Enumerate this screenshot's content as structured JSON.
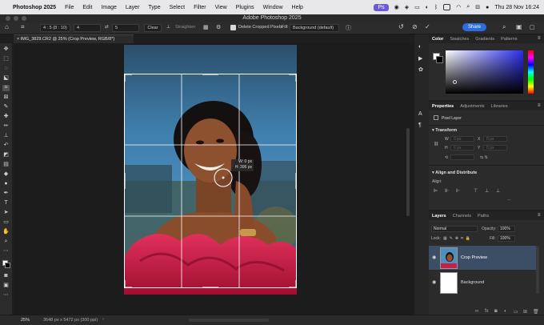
{
  "menubar": {
    "apple": "",
    "app_name": "Photoshop 2025",
    "items": [
      "File",
      "Edit",
      "Image",
      "Layer",
      "Type",
      "Select",
      "Filter",
      "View",
      "Plugins",
      "Window",
      "Help"
    ],
    "ps_badge": "Ps",
    "datetime": "Thu 28 Nov 16:24"
  },
  "window": {
    "title": "Adobe Photoshop 2025"
  },
  "options": {
    "ratio": "4 : 5 (8 : 10)",
    "width_value": "4",
    "height_value": "5",
    "clear_label": "Clear",
    "straighten_label": "Straighten",
    "delete_cropped_label": "Delete Cropped Pixels",
    "fill_label": "Fill:",
    "fill_value": "Background (default)",
    "share_label": "Share"
  },
  "document": {
    "tab_title": "IMG_3829.CR2 @ 25% (Crop Preview, RGB/8*)"
  },
  "canvas": {
    "crop_readout_w": "W: 0 px",
    "crop_readout_h": "H: 306 px"
  },
  "status": {
    "zoom": "25%",
    "info": "3648 px x 5472 px (300 ppi)"
  },
  "color_panel": {
    "tabs": [
      "Color",
      "Swatches",
      "Gradients",
      "Patterns"
    ],
    "hue_hex": "#2c2ef2"
  },
  "properties_panel": {
    "tabs": [
      "Properties",
      "Adjustments",
      "Libraries"
    ],
    "kind": "Pixel Layer",
    "transform_label": "Transform",
    "w_label": "W",
    "w_placeholder": "0 px",
    "h_label": "H",
    "h_placeholder": "0 px",
    "x_label": "X",
    "x_placeholder": "0 px",
    "y_label": "Y",
    "y_placeholder": "0 px",
    "align_label": "Align and Distribute",
    "align_sub": "Align:"
  },
  "layers_panel": {
    "tabs": [
      "Layers",
      "Channels",
      "Paths"
    ],
    "blend_mode": "Normal",
    "opacity_label": "Opacity:",
    "opacity_value": "100%",
    "lock_label": "Lock:",
    "fill_label": "Fill:",
    "fill_value": "100%",
    "layers": [
      {
        "name": "Crop Preview",
        "selected": true
      },
      {
        "name": "Background",
        "selected": false
      }
    ]
  }
}
